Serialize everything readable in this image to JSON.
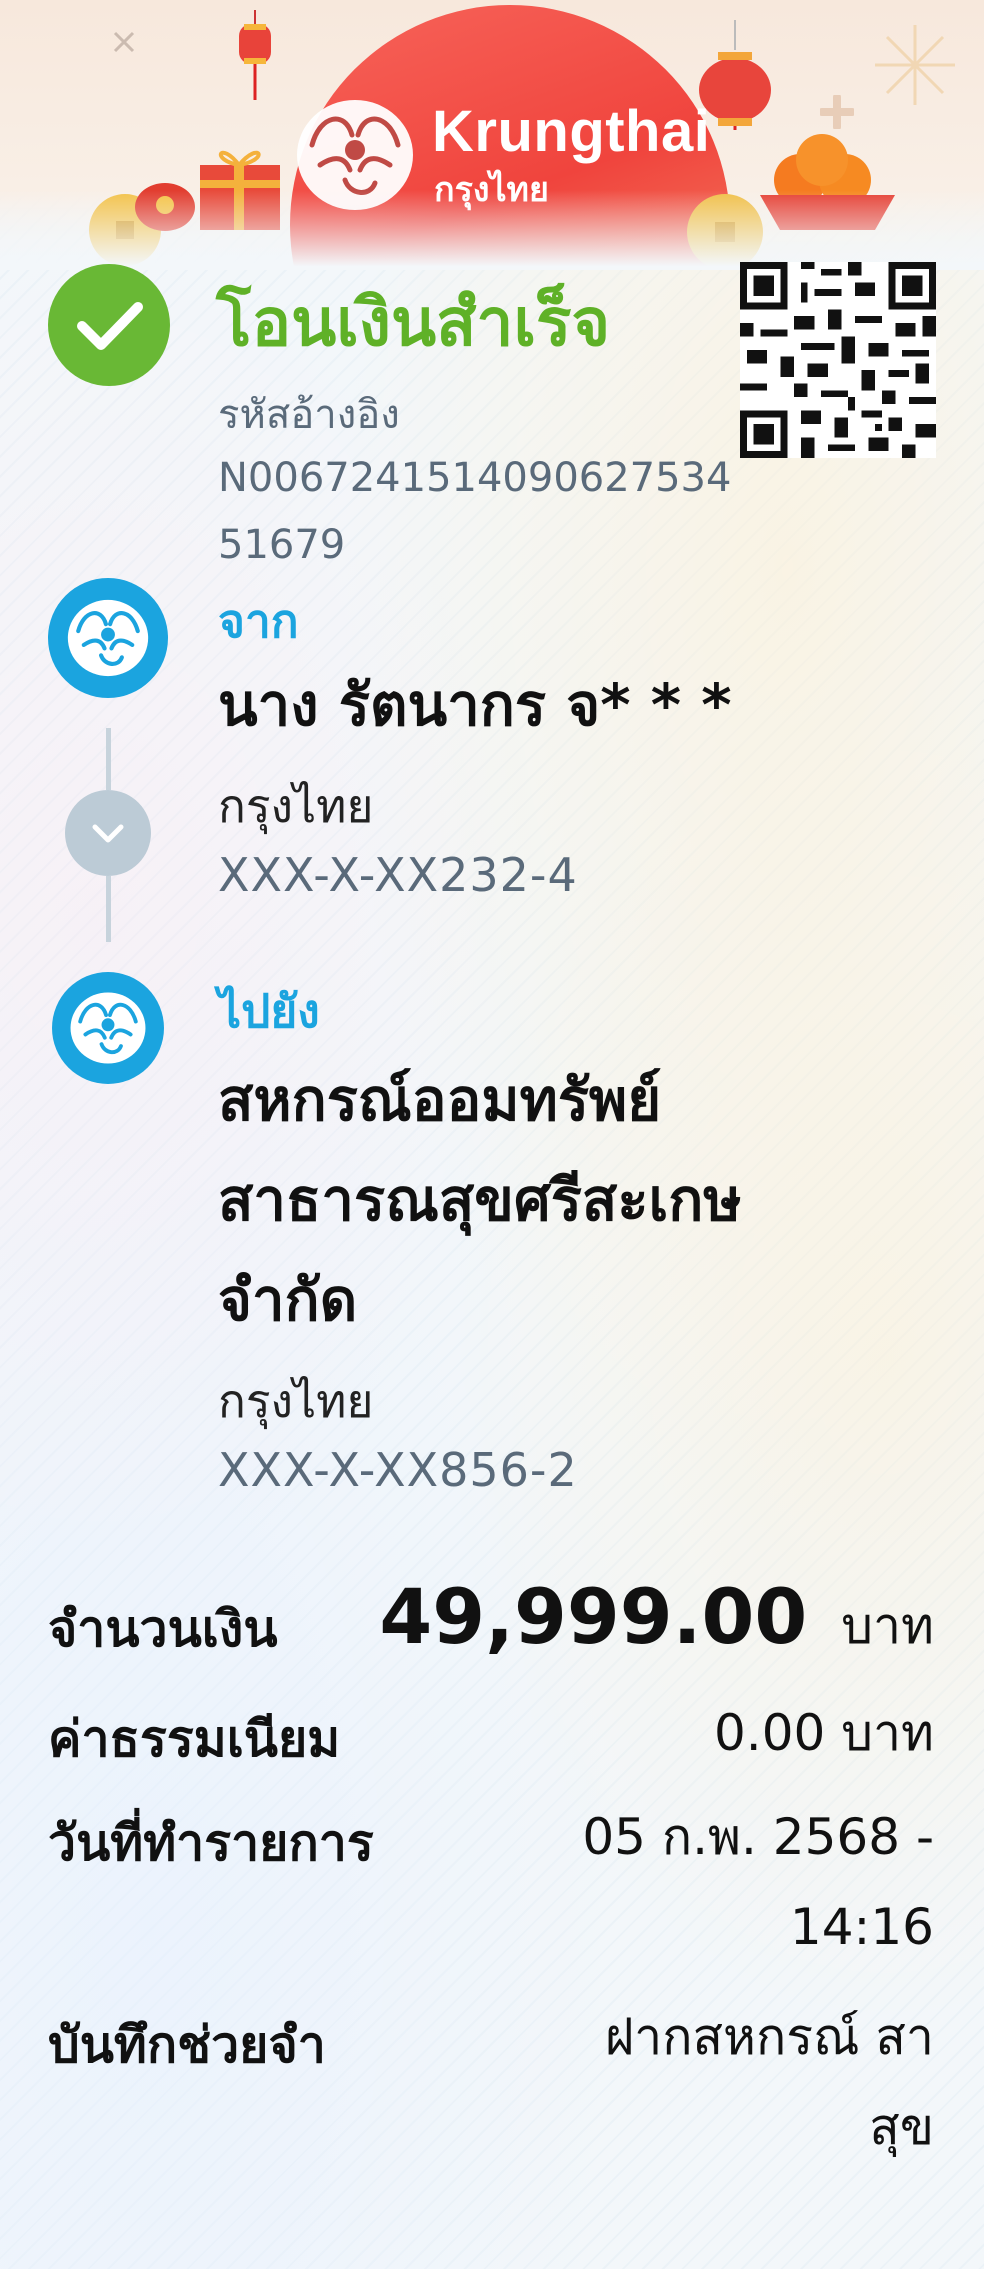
{
  "bank": {
    "brand_en": "Krungthai",
    "brand_th": "กรุงไทย"
  },
  "status": {
    "title": "โอนเงินสำเร็จ",
    "ref_label": "รหัสอ้างอิง",
    "ref_value": "N0067241514090627534 51679"
  },
  "from": {
    "label": "จาก",
    "name": "นาง รัตนากร จ* * *",
    "bank": "กรุงไทย",
    "account": "XXX-X-XX232-4"
  },
  "to": {
    "label": "ไปยัง",
    "name_line1": "สหกรณ์ออมทรัพย์",
    "name_line2": "สาธารณสุขศรีสะเกษ",
    "name_line3": "จำกัด",
    "bank": "กรุงไทย",
    "account": "XXX-X-XX856-2"
  },
  "details": {
    "amount_label": "จำนวนเงิน",
    "amount_value": "49,999.00",
    "amount_unit": "บาท",
    "fee_label": "ค่าธรรมเนียม",
    "fee_value": "0.00 บาท",
    "date_label": "วันที่ทำรายการ",
    "date_line1": "05 ก.พ. 2568 -",
    "date_line2": "14:16",
    "memo_label": "บันทึกช่วยจำ",
    "memo_line1": "ฝากสหกรณ์ สา",
    "memo_line2": "สุข"
  },
  "icons": {
    "success": "check-icon",
    "bank_logo": "krungthai-bird-icon",
    "qr": "qr-code-icon",
    "expand": "chevron-down-icon"
  },
  "colors": {
    "success_green": "#5fb127",
    "brand_blue": "#1ba4df",
    "banner_red": "#f0443d"
  }
}
